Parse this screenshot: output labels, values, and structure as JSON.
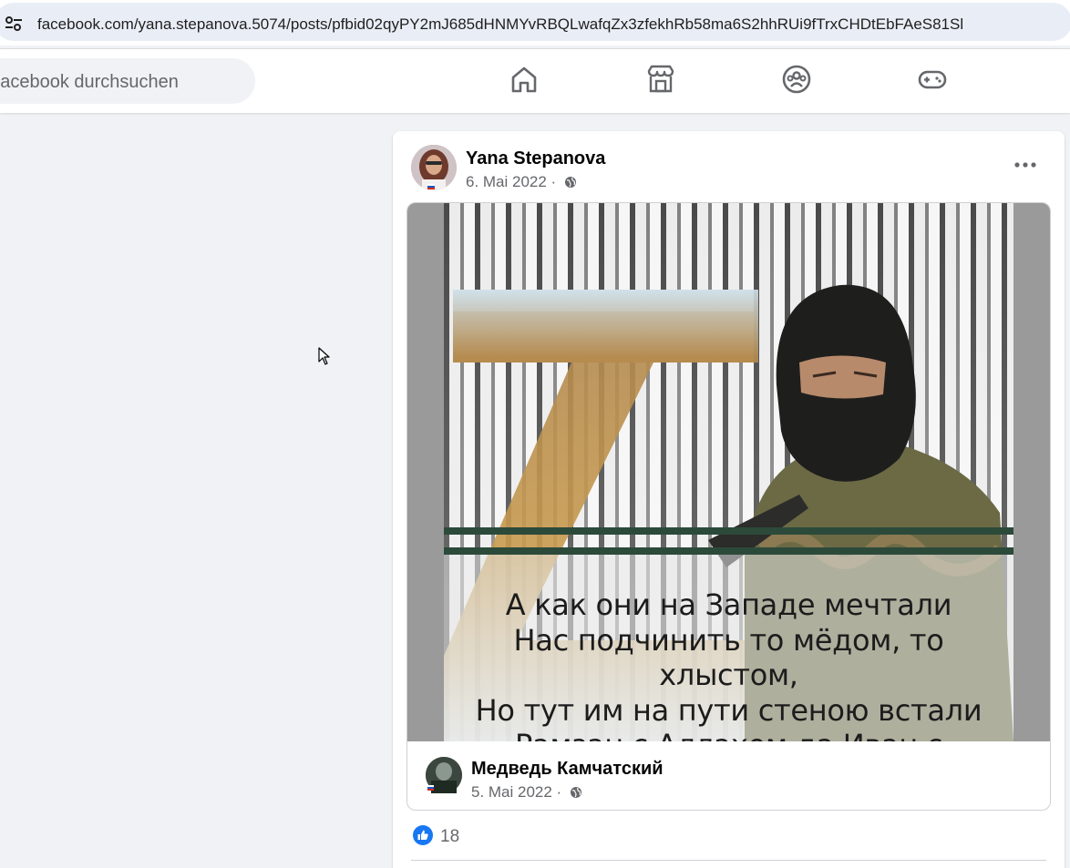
{
  "browser": {
    "url": "facebook.com/yana.stepanova.5074/posts/pfbid02qyPY2mJ685dHNMYvRBQLwafqZx3zfekhRb58ma6S2hhRUi9fTrxCHDtEbFAeS81Sl",
    "site_info_icon": "tune-icon"
  },
  "nav": {
    "search_placeholder": "Facebook durchsuchen",
    "icons": [
      "home-icon",
      "marketplace-icon",
      "groups-icon",
      "gaming-icon"
    ]
  },
  "post": {
    "author": "Yana Stepanova",
    "date": "6. Mai 2022 ·",
    "privacy_icon": "globe-icon",
    "menu_icon": "more-icon",
    "shared": {
      "image_lines": [
        "А как они на Западе мечтали",
        "Нас подчинить то мёдом, то хлыстом,",
        "Но тут им на пути стеною встали",
        "Рамзан с  Аллахом да Иван с Христом!"
      ],
      "author": "Медведь Камчатский",
      "date": "5. Mai 2022 ·"
    },
    "reactions": {
      "icon": "like-icon",
      "count": "18"
    }
  },
  "colors": {
    "accent": "#1877f2",
    "background": "#f0f2f5",
    "address_bar": "#e9eef6",
    "secondary_text": "#65676b"
  }
}
